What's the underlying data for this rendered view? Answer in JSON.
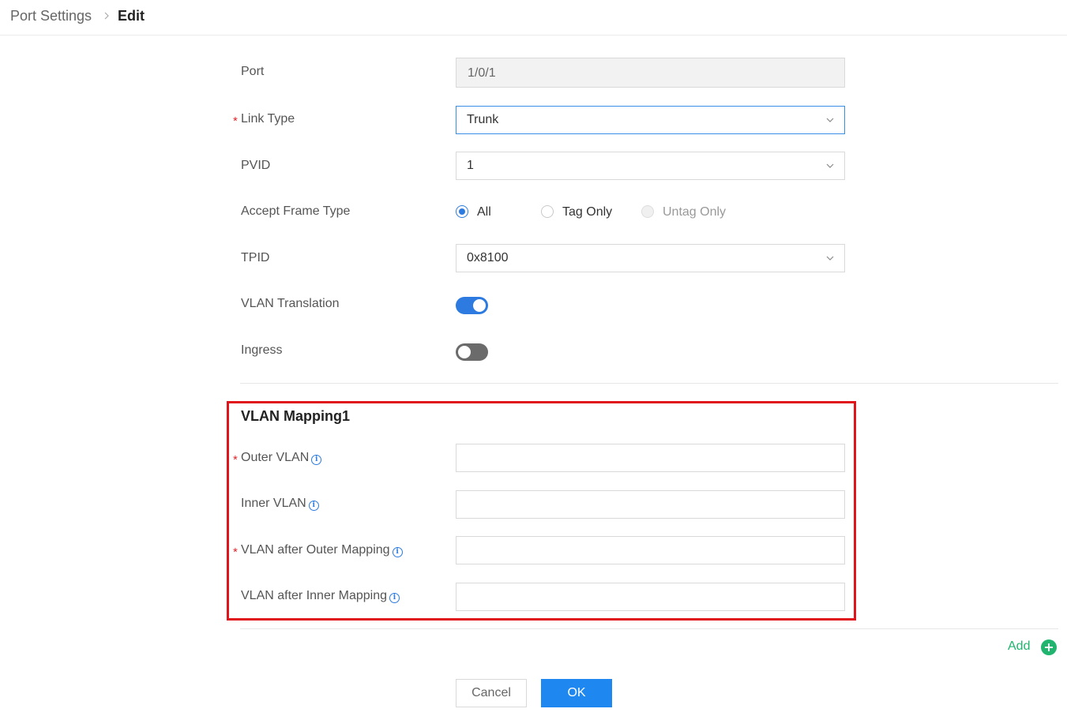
{
  "breadcrumb": {
    "root": "Port Settings",
    "current": "Edit"
  },
  "form": {
    "port": {
      "label": "Port",
      "value": "1/0/1"
    },
    "link_type": {
      "label": "Link Type",
      "value": "Trunk",
      "required_mark": "*"
    },
    "pvid": {
      "label": "PVID",
      "value": "1"
    },
    "accept_frame_type": {
      "label": "Accept Frame Type",
      "options": [
        "All",
        "Tag Only",
        "Untag Only"
      ],
      "selected": "All"
    },
    "tpid": {
      "label": "TPID",
      "value": "0x8100"
    },
    "vlan_translation": {
      "label": "VLAN Translation",
      "enabled": true
    },
    "ingress": {
      "label": "Ingress",
      "enabled": false
    }
  },
  "mapping": {
    "title": "VLAN Mapping1",
    "outer_vlan": {
      "label": "Outer VLAN",
      "value": "",
      "required_mark": "*"
    },
    "inner_vlan": {
      "label": "Inner VLAN",
      "value": ""
    },
    "vlan_after_outer": {
      "label": "VLAN after Outer Mapping",
      "value": "",
      "required_mark": "*"
    },
    "vlan_after_inner": {
      "label": "VLAN after Inner Mapping",
      "value": ""
    }
  },
  "add": {
    "label": "Add"
  },
  "buttons": {
    "cancel": "Cancel",
    "ok": "OK"
  },
  "icons": {
    "info": "i",
    "required": "*"
  },
  "colors": {
    "accent": "#2d7be0",
    "add": "#1fb56e",
    "highlight": "#e0151b",
    "required": "#e0262c"
  }
}
